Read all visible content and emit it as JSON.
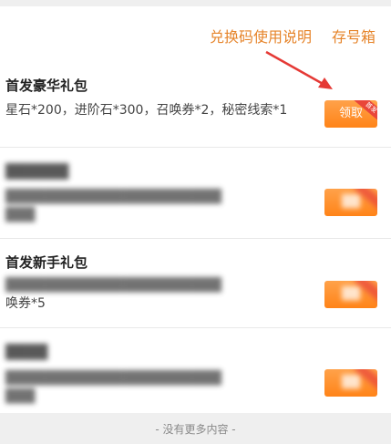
{
  "header": {
    "redeem_help": "兑换码使用说明",
    "storage_box": "存号箱"
  },
  "packs": [
    {
      "title": "首发豪华礼包",
      "desc": "星石*200，进阶石*300，召唤券*2，秘密线索*1",
      "button": "领取",
      "badge": "首发"
    },
    {
      "title": "",
      "desc": "",
      "button": "",
      "badge": ""
    },
    {
      "title": "首发新手礼包",
      "desc_visible": "唤券*5",
      "button": "",
      "badge": ""
    },
    {
      "title": "",
      "desc": "",
      "button": "",
      "badge": ""
    }
  ],
  "footer": {
    "text": "- 没有更多内容 -"
  },
  "colors": {
    "accent": "#e6842a",
    "button": "#ff8c25",
    "badge": "#e9463a",
    "arrow": "#e53935"
  }
}
